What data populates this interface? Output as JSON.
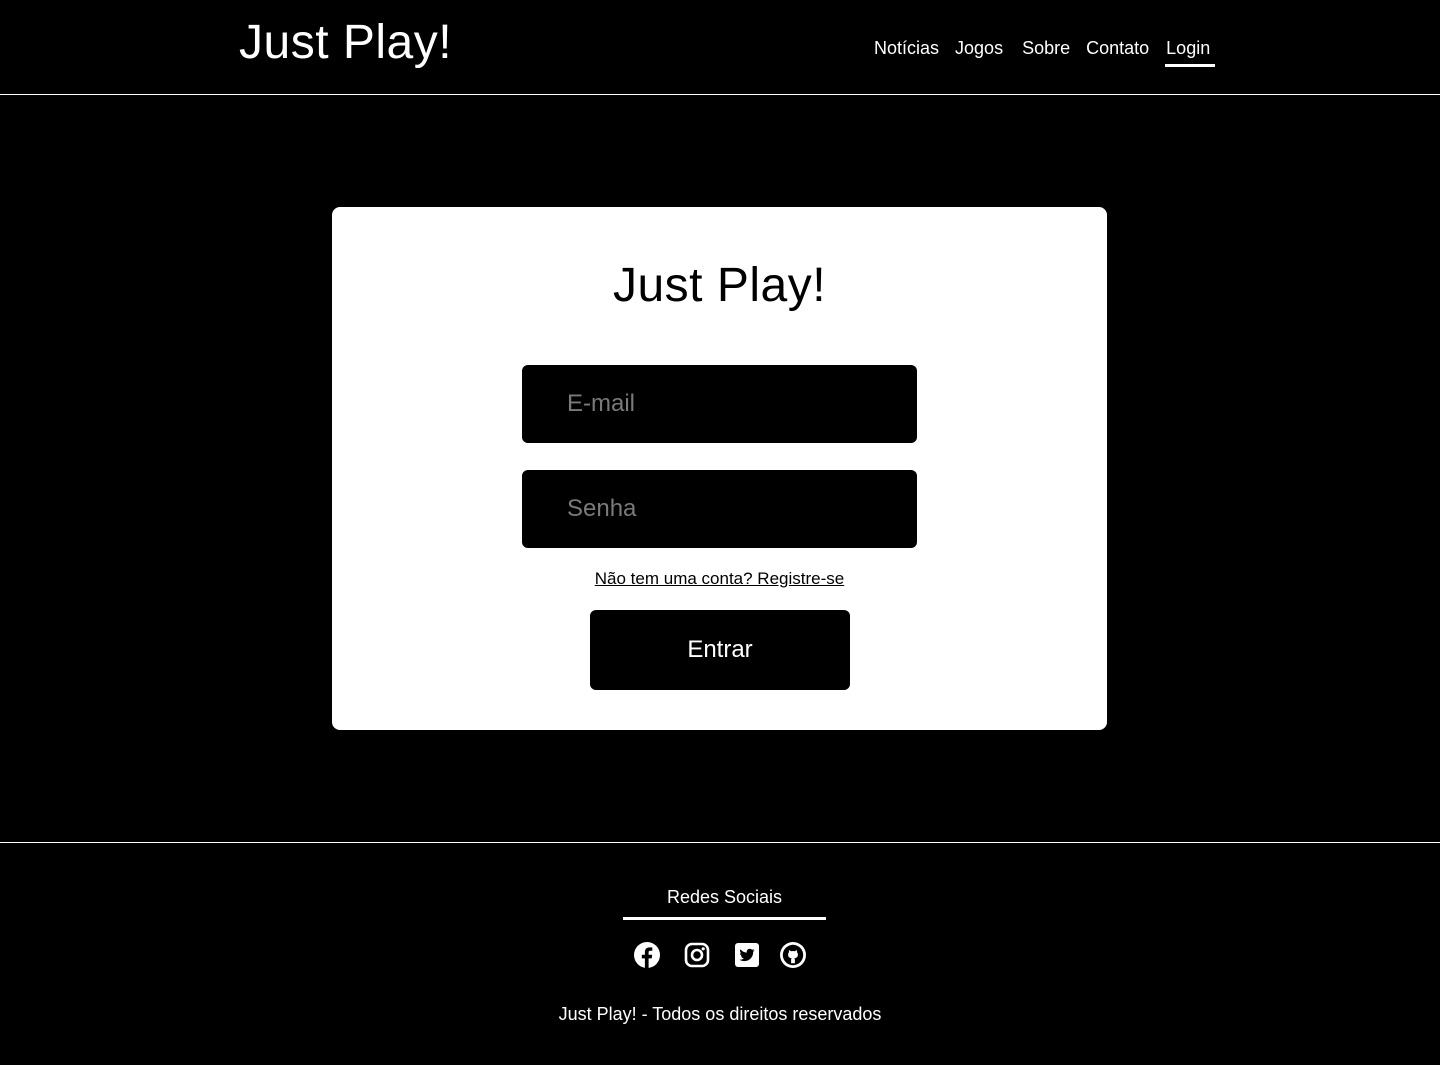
{
  "header": {
    "brand": "Just Play!",
    "nav": [
      {
        "label": "Notícias"
      },
      {
        "label": "Jogos"
      },
      {
        "label": "Sobre"
      },
      {
        "label": "Contato"
      },
      {
        "label": "Login",
        "active": true
      }
    ]
  },
  "login_card": {
    "title": "Just Play!",
    "email_placeholder": "E-mail",
    "email_value": "",
    "password_placeholder": "Senha",
    "password_value": "",
    "register_link": "Não tem uma conta? Registre-se",
    "submit_label": "Entrar"
  },
  "footer": {
    "social_heading": "Redes Sociais",
    "social_icons": [
      "facebook-icon",
      "instagram-icon",
      "twitter-icon",
      "github-icon"
    ],
    "copyright": "Just Play! - Todos os direitos reservados"
  },
  "colors": {
    "background": "#000000",
    "card": "#ffffff",
    "text_light": "#ffffff",
    "placeholder": "#7a7a7a"
  }
}
